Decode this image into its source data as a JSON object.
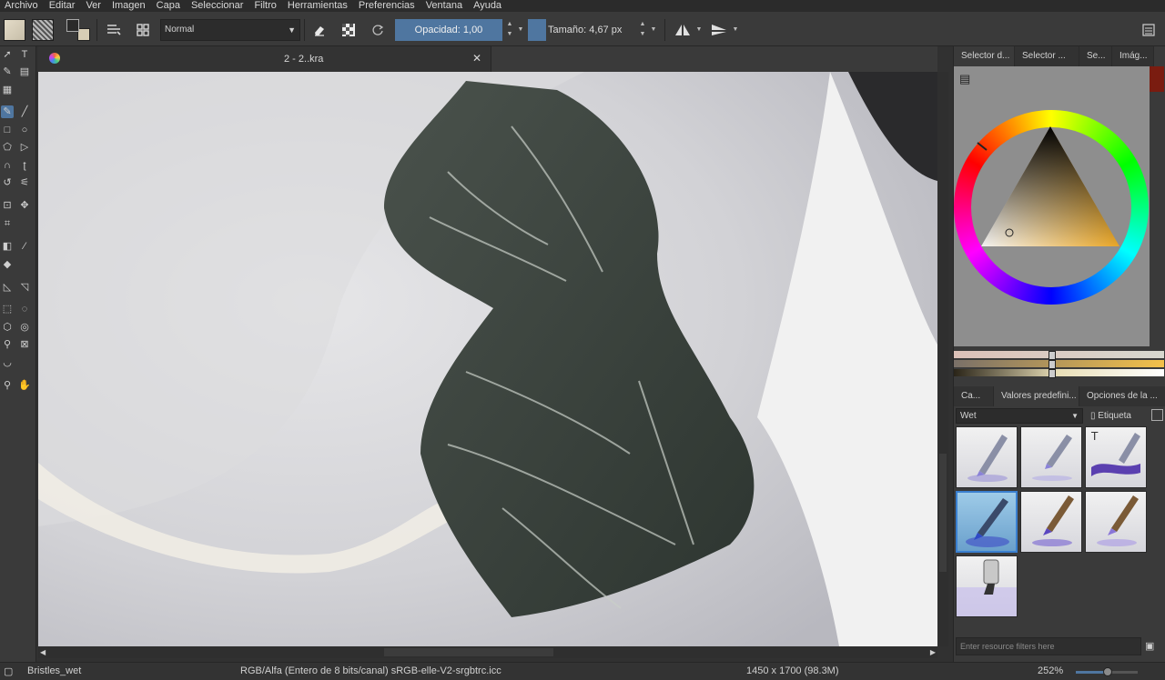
{
  "menubar": [
    "Archivo",
    "Editar",
    "Ver",
    "Imagen",
    "Capa",
    "Seleccionar",
    "Filtro",
    "Herramientas",
    "Preferencias",
    "Ventana",
    "Ayuda"
  ],
  "toolbar": {
    "blend_mode": "Normal",
    "opacity_label": "Opacidad:",
    "opacity_value": "1,00",
    "size_label": "Tamaño:",
    "size_value": "4,67 px"
  },
  "document": {
    "tab_title": "2 - 2..kra"
  },
  "right_panel": {
    "top_tabs": [
      "Selector d...",
      "Selector ...",
      "Se...",
      "Imág..."
    ],
    "preset_tabs": [
      "Ca...",
      "Valores predefini...",
      "Opciones de la ..."
    ],
    "preset_tag": "Wet",
    "tag_button": "Etiqueta",
    "filter_placeholder": "Enter resource filters here"
  },
  "colors": {
    "accent": "#4f76a0",
    "selected_preset": "#3a7fcf"
  },
  "statusbar": {
    "brush_name": "Bristles_wet",
    "color_space": "RGB/Alfa (Entero de 8 bits/canal)  sRGB-elle-V2-srgbtrc.icc",
    "dimensions": "1450 x 1700 (98.3M)",
    "zoom": "252%"
  },
  "zoom_fraction": 0.52
}
